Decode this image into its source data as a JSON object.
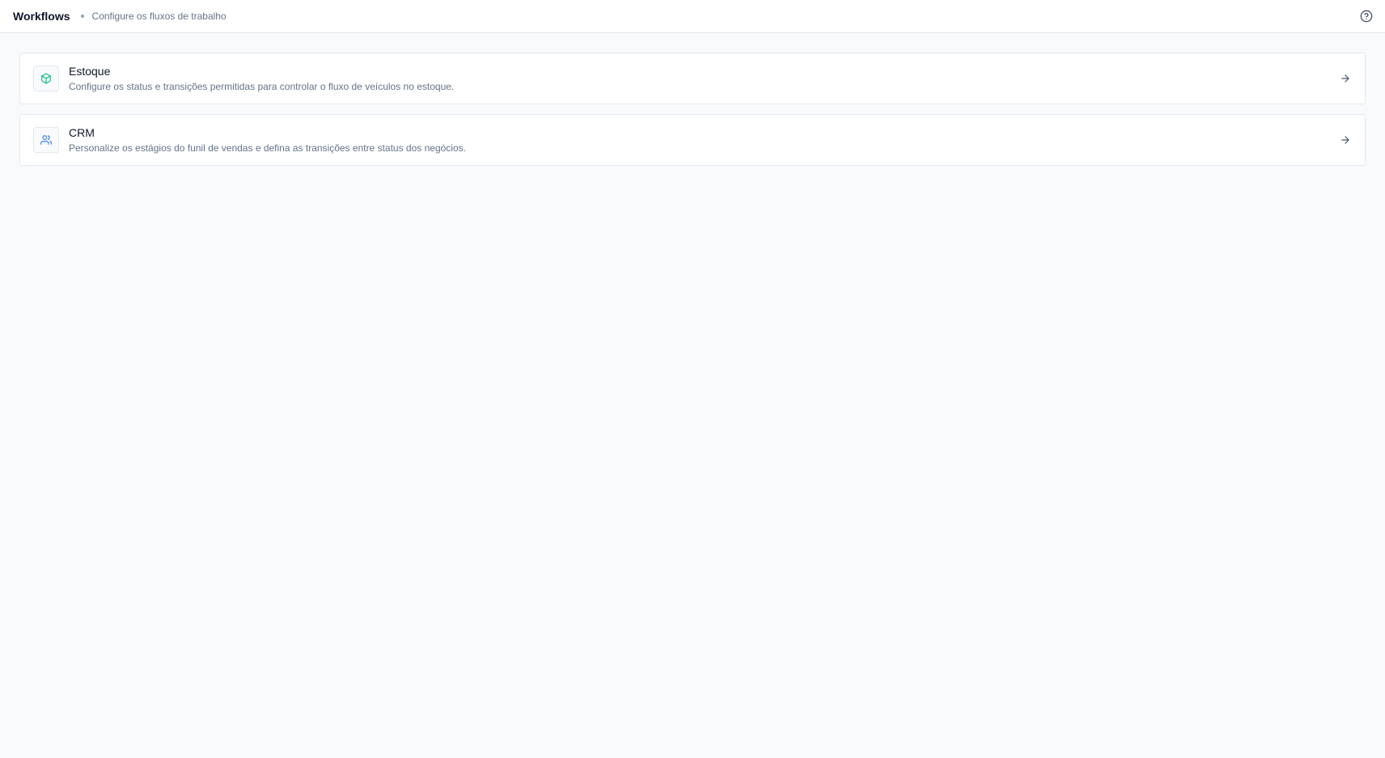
{
  "header": {
    "title": "Workflows",
    "subtitle": "Configure os fluxos de trabalho",
    "help_icon": "help-circle-icon"
  },
  "cards": [
    {
      "title": "Estoque",
      "description": "Configure os status e transições permitidas para controlar o fluxo de veículos no estoque.",
      "icon": "package-icon",
      "icon_color": "#10b981",
      "arrow_icon": "arrow-right-icon"
    },
    {
      "title": "CRM",
      "description": "Personalize os estágios do funil de vendas e defina as transições entre status dos negócios.",
      "icon": "users-icon",
      "icon_color": "#3b82f6",
      "arrow_icon": "arrow-right-icon"
    }
  ],
  "colors": {
    "background": "#f8fafc",
    "surface": "#ffffff",
    "border": "#e2e8f0",
    "text_primary": "#0f172a",
    "text_secondary": "#64748b"
  }
}
